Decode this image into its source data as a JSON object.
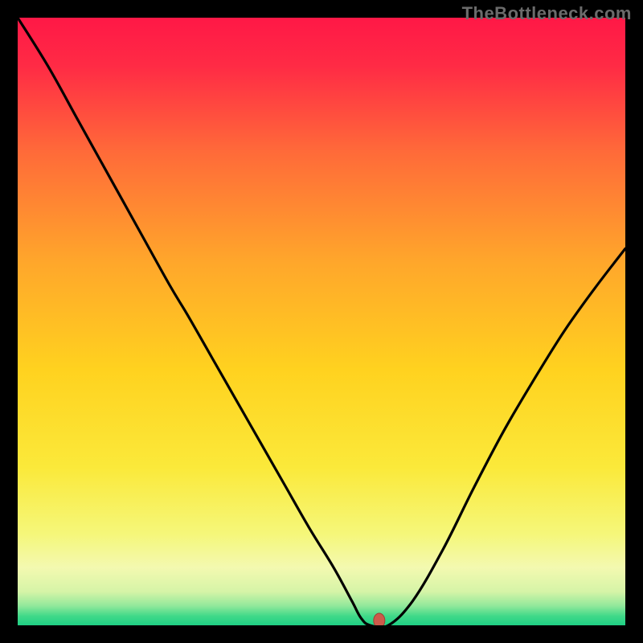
{
  "watermark": "TheBottleneck.com",
  "colors": {
    "background": "#000000",
    "curve": "#000000",
    "marker_fill": "#cc5a4a",
    "marker_stroke": "#9e3e31",
    "gradient_stops": [
      {
        "offset": 0,
        "color": "#ff1846"
      },
      {
        "offset": 0.08,
        "color": "#ff2b45"
      },
      {
        "offset": 0.22,
        "color": "#ff6a39"
      },
      {
        "offset": 0.4,
        "color": "#ffa62b"
      },
      {
        "offset": 0.58,
        "color": "#ffd21f"
      },
      {
        "offset": 0.74,
        "color": "#fbe93a"
      },
      {
        "offset": 0.85,
        "color": "#f5f77a"
      },
      {
        "offset": 0.905,
        "color": "#f3f9b0"
      },
      {
        "offset": 0.945,
        "color": "#d5f4a7"
      },
      {
        "offset": 0.968,
        "color": "#91e89b"
      },
      {
        "offset": 0.985,
        "color": "#3fd989"
      },
      {
        "offset": 1.0,
        "color": "#1fcf84"
      }
    ]
  },
  "chart_data": {
    "type": "line",
    "title": "",
    "xlabel": "",
    "ylabel": "",
    "x": [
      0.0,
      0.05,
      0.1,
      0.15,
      0.2,
      0.25,
      0.28,
      0.32,
      0.36,
      0.4,
      0.44,
      0.48,
      0.52,
      0.55,
      0.565,
      0.58,
      0.61,
      0.65,
      0.7,
      0.75,
      0.8,
      0.85,
      0.9,
      0.95,
      1.0
    ],
    "y": [
      1.0,
      0.92,
      0.83,
      0.74,
      0.65,
      0.56,
      0.51,
      0.44,
      0.37,
      0.3,
      0.23,
      0.16,
      0.095,
      0.04,
      0.012,
      0.0,
      0.0,
      0.04,
      0.125,
      0.225,
      0.32,
      0.405,
      0.485,
      0.555,
      0.62
    ],
    "xlim": [
      0,
      1
    ],
    "ylim": [
      0,
      1
    ],
    "marker": {
      "x": 0.595,
      "y": 0.0
    },
    "legend": []
  }
}
